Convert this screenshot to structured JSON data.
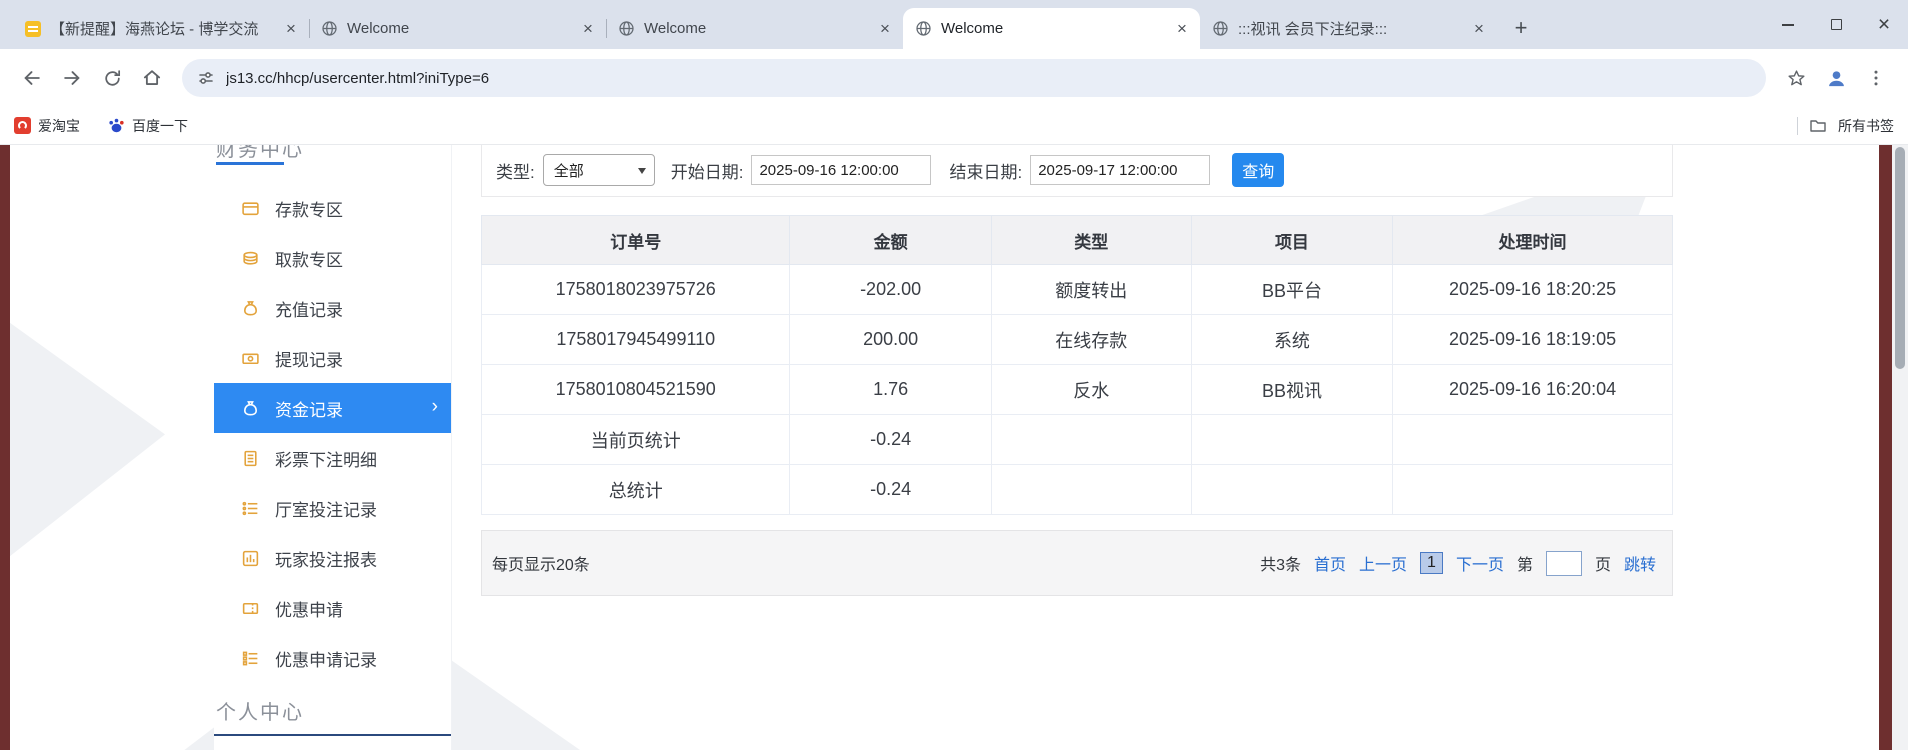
{
  "browser": {
    "tabs": [
      {
        "title": "【新提醒】海燕论坛 - 博学交流"
      },
      {
        "title": "Welcome"
      },
      {
        "title": "Welcome"
      },
      {
        "title": "Welcome"
      },
      {
        "title": ":::视讯 会员下注纪录:::"
      }
    ],
    "url": "js13.cc/hhcp/usercenter.html?iniType=6",
    "bookmarks": {
      "taobao": "爱淘宝",
      "baidu": "百度一下",
      "all_bookmarks": "所有书签"
    }
  },
  "sidebar": {
    "finance_section": "财务中心",
    "personal_section": "个人中心",
    "items": [
      {
        "label": "存款专区"
      },
      {
        "label": "取款专区"
      },
      {
        "label": "充值记录"
      },
      {
        "label": "提现记录"
      },
      {
        "label": "资金记录"
      },
      {
        "label": "彩票下注明细"
      },
      {
        "label": "厅室投注记录"
      },
      {
        "label": "玩家投注报表"
      },
      {
        "label": "优惠申请"
      },
      {
        "label": "优惠申请记录"
      }
    ],
    "active_item": "资金记录"
  },
  "filters": {
    "type_label": "类型:",
    "type_value": "全部",
    "start_date_label": "开始日期:",
    "start_date_value": "2025-09-16 12:00:00",
    "end_date_label": "结束日期:",
    "end_date_value": "2025-09-17 12:00:00",
    "query_button": "查询"
  },
  "table": {
    "headers": [
      "订单号",
      "金额",
      "类型",
      "项目",
      "处理时间"
    ],
    "rows": [
      [
        "1758018023975726",
        "-202.00",
        "额度转出",
        "BB平台",
        "2025-09-16 18:20:25"
      ],
      [
        "1758017945499110",
        "200.00",
        "在线存款",
        "系统",
        "2025-09-16 18:19:05"
      ],
      [
        "1758010804521590",
        "1.76",
        "反水",
        "BB视讯",
        "2025-09-16 16:20:04"
      ],
      [
        "当前页统计",
        "-0.24",
        "",
        "",
        ""
      ],
      [
        "总统计",
        "-0.24",
        "",
        "",
        ""
      ]
    ]
  },
  "pagination": {
    "page_size_text": "每页显示20条",
    "total_text": "共3条",
    "first_label": "首页",
    "prev_label": "上一页",
    "current_page": "1",
    "next_label": "下一页",
    "jump_prefix": "第",
    "jump_suffix": "页",
    "jump_button": "跳转",
    "jump_value": ""
  },
  "colors": {
    "accent_blue": "#2589ee",
    "active_item_blue": "#2e8af2",
    "link_blue": "#2a6fd1",
    "sidebar_icon_orange": "#e3a33b",
    "edge_strip_maroon": "#6e2f2f"
  }
}
